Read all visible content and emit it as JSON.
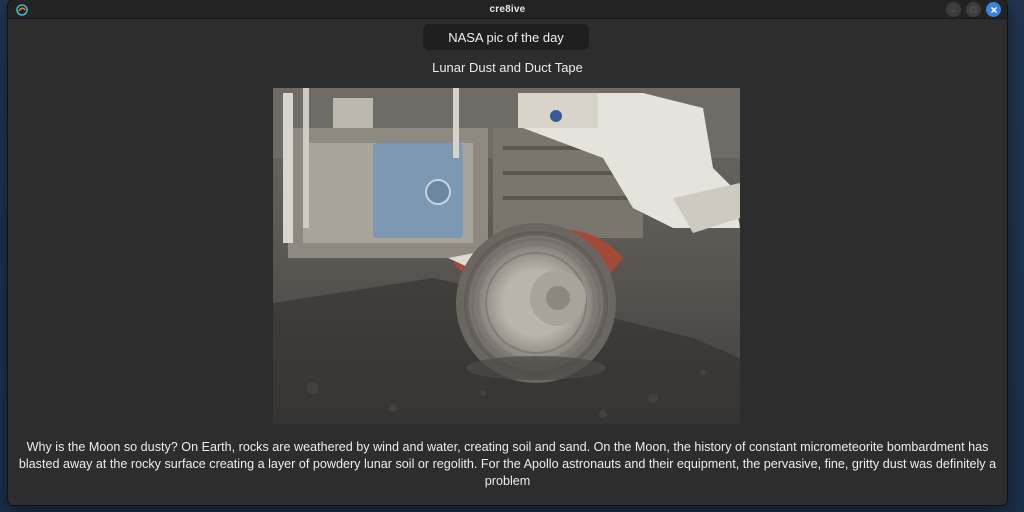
{
  "window": {
    "title": "cre8ive",
    "controls": [
      "minimize-button",
      "maximize-button",
      "close-button"
    ]
  },
  "header": {
    "button_label": "NASA pic of the day"
  },
  "picture": {
    "title": "Lunar Dust and Duct Tape",
    "alt_icon": "apollo-rover-photo",
    "description": "Why is the Moon so dusty? On Earth, rocks are weathered by wind and water, creating soil and sand. On the Moon, the history of constant micrometeorite bombardment has blasted away at the rocky surface creating a layer of powdery lunar soil or regolith. For the Apollo astronauts and their equipment, the pervasive, fine, gritty dust was definitely a problem"
  },
  "colors": {
    "accent": "#3584e4",
    "window_bg": "#2d2d2d",
    "titlebar_bg": "#232323"
  }
}
